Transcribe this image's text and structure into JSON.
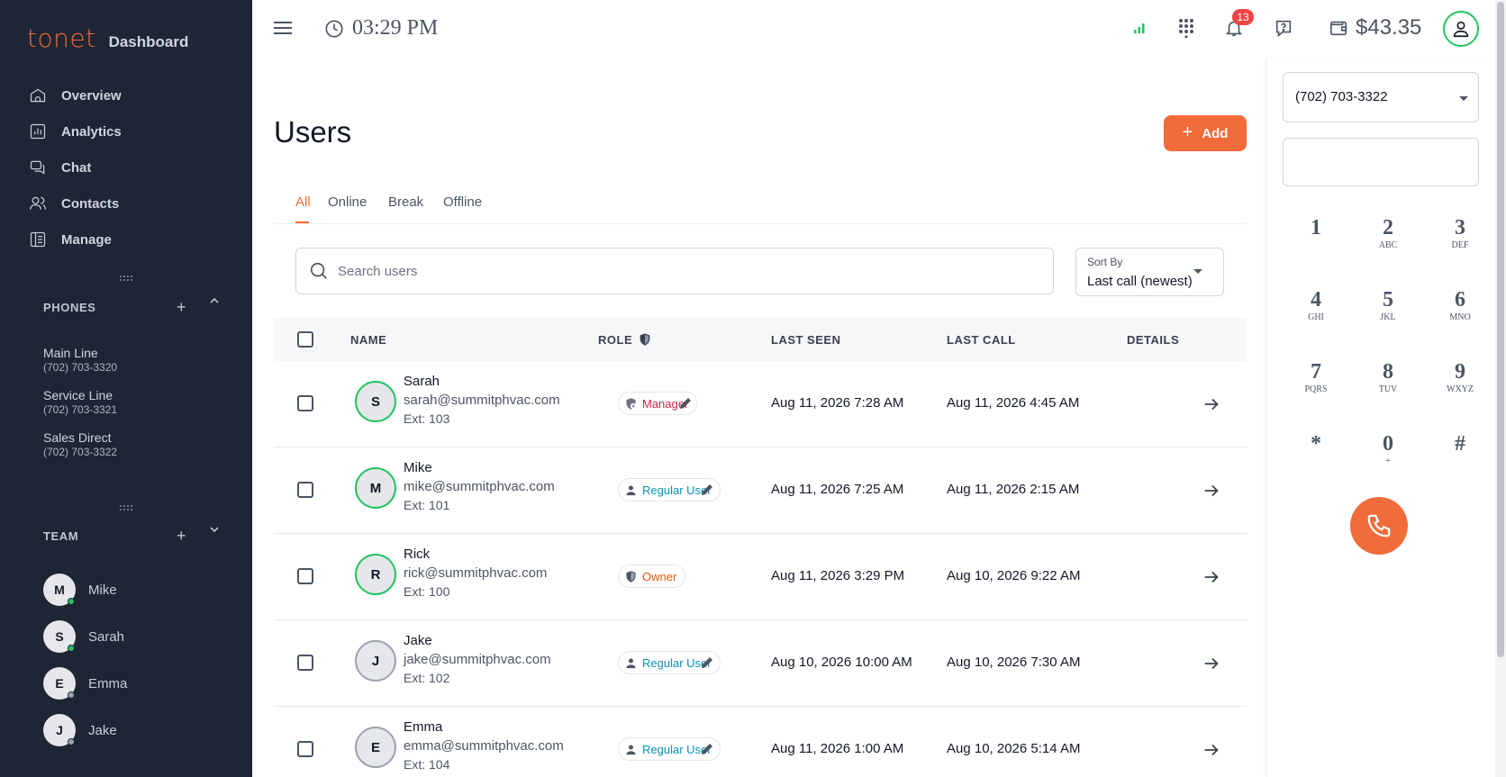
{
  "brand": {
    "logo_text": "tonet",
    "title": "Dashboard",
    "accent": "#f26b3a"
  },
  "nav": [
    {
      "label": "Overview",
      "icon": "home-icon"
    },
    {
      "label": "Analytics",
      "icon": "analytics-icon"
    },
    {
      "label": "Chat",
      "icon": "chat-icon"
    },
    {
      "label": "Contacts",
      "icon": "contacts-icon"
    },
    {
      "label": "Manage",
      "icon": "manage-icon"
    }
  ],
  "phones": {
    "heading": "PHONES",
    "items": [
      {
        "name": "Main Line",
        "number": "(702) 703-3320"
      },
      {
        "name": "Service Line",
        "number": "(702) 703-3321"
      },
      {
        "name": "Sales Direct",
        "number": "(702) 703-3322"
      }
    ]
  },
  "team": {
    "heading": "TEAM",
    "members": [
      {
        "initial": "M",
        "name": "Mike",
        "status": "online",
        "status_color": "#22c55e"
      },
      {
        "initial": "S",
        "name": "Sarah",
        "status": "online",
        "status_color": "#22c55e"
      },
      {
        "initial": "E",
        "name": "Emma",
        "status": "offline",
        "status_color": "#9ca3af"
      },
      {
        "initial": "J",
        "name": "Jake",
        "status": "offline",
        "status_color": "#9ca3af"
      }
    ]
  },
  "topbar": {
    "time": "03:29 PM",
    "notifications_count": "13",
    "balance": "$43.35"
  },
  "page": {
    "title": "Users",
    "add_label": "Add"
  },
  "tabs": [
    "All",
    "Online",
    "Break",
    "Offline"
  ],
  "active_tab": "All",
  "search": {
    "placeholder": "Search users",
    "value": ""
  },
  "sort": {
    "label": "Sort By",
    "value": "Last call (newest)"
  },
  "table": {
    "headers": {
      "name": "NAME",
      "role": "ROLE",
      "last_seen": "LAST SEEN",
      "last_call": "LAST CALL",
      "details": "DETAILS"
    },
    "rows": [
      {
        "initial": "S",
        "name": "Sarah",
        "email": "sarah@summitphvac.com",
        "ext": "Ext: 103",
        "role": "Manager",
        "role_icon": "manager-shield-icon",
        "editable": true,
        "last_seen": "Aug 11, 2026 7:28 AM",
        "last_call": "Aug 11, 2026 4:45 AM",
        "status": "online"
      },
      {
        "initial": "M",
        "name": "Mike",
        "email": "mike@summitphvac.com",
        "ext": "Ext: 101",
        "role": "Regular User",
        "role_icon": "user-icon",
        "editable": true,
        "last_seen": "Aug 11, 2026 7:25 AM",
        "last_call": "Aug 11, 2026 2:15 AM",
        "status": "online"
      },
      {
        "initial": "R",
        "name": "Rick",
        "email": "rick@summitphvac.com",
        "ext": "Ext: 100",
        "role": "Owner",
        "role_icon": "shield-icon",
        "editable": false,
        "last_seen": "Aug 11, 2026 3:29 PM",
        "last_call": "Aug 10, 2026 9:22 AM",
        "status": "online"
      },
      {
        "initial": "J",
        "name": "Jake",
        "email": "jake@summitphvac.com",
        "ext": "Ext: 102",
        "role": "Regular User",
        "role_icon": "user-icon",
        "editable": true,
        "last_seen": "Aug 10, 2026 10:00 AM",
        "last_call": "Aug 10, 2026 7:30 AM",
        "status": "offline"
      },
      {
        "initial": "E",
        "name": "Emma",
        "email": "emma@summitphvac.com",
        "ext": "Ext: 104",
        "role": "Regular User",
        "role_icon": "user-icon",
        "editable": true,
        "last_seen": "Aug 11, 2026 1:00 AM",
        "last_call": "Aug 10, 2026 5:14 AM",
        "status": "offline"
      }
    ]
  },
  "role_colors": {
    "Manager": "#e11d48",
    "Regular User": "#0891b2",
    "Owner": "#ea580c"
  },
  "dialer": {
    "selected_number": "(702) 703-3322",
    "input_value": "",
    "keys": [
      {
        "digit": "1",
        "letters": ""
      },
      {
        "digit": "2",
        "letters": "ABC"
      },
      {
        "digit": "3",
        "letters": "DEF"
      },
      {
        "digit": "4",
        "letters": "GHI"
      },
      {
        "digit": "5",
        "letters": "JKL"
      },
      {
        "digit": "6",
        "letters": "MNO"
      },
      {
        "digit": "7",
        "letters": "PQRS"
      },
      {
        "digit": "8",
        "letters": "TUV"
      },
      {
        "digit": "9",
        "letters": "WXYZ"
      },
      {
        "digit": "*",
        "letters": ""
      },
      {
        "digit": "0",
        "letters": "+"
      },
      {
        "digit": "#",
        "letters": ""
      }
    ]
  }
}
